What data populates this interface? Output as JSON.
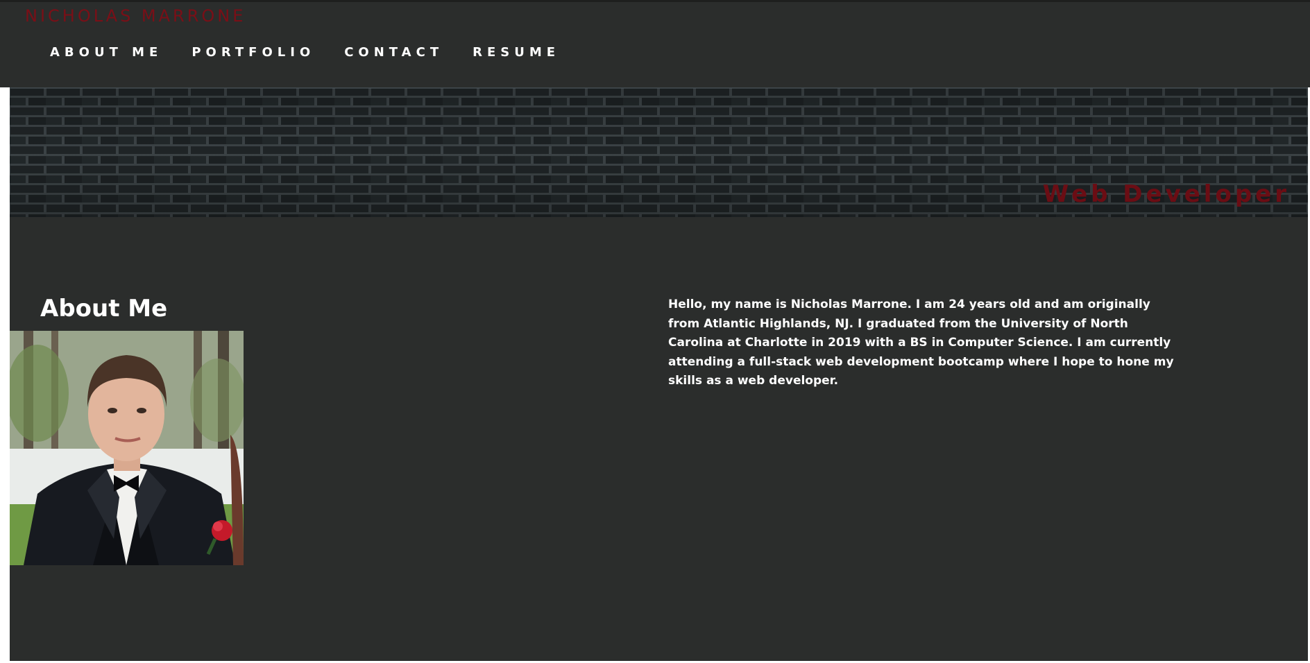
{
  "header": {
    "site_title": "NICHOLAS MARRONE",
    "nav": [
      {
        "label": "ABOUT ME"
      },
      {
        "label": "PORTFOLIO"
      },
      {
        "label": "CONTACT"
      },
      {
        "label": "RESUME"
      }
    ]
  },
  "banner": {
    "tagline": "Web Developer"
  },
  "about": {
    "heading": "About Me",
    "photo_icon": "profile-photo",
    "bio": "Hello, my name is Nicholas Marrone. I am 24 years old and am originally from Atlantic Highlands, NJ. I graduated from the University of North Carolina at Charlotte in 2019 with a BS in Computer Science. I am currently attending a full-stack web development bootcamp where I hope to hone my skills as a web developer."
  },
  "colors": {
    "background": "#2b2d2c",
    "accent_red": "#7a0f17",
    "text": "#ffffff"
  }
}
